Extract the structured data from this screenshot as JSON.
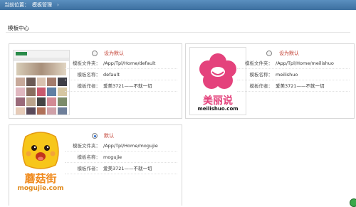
{
  "breadcrumb": {
    "prefix": "当前位置：",
    "current": "模板管理"
  },
  "page_title": "模板中心",
  "field_labels": {
    "path": "模板文件夹：",
    "name": "模板名称：",
    "author": "模板作者："
  },
  "templates": [
    {
      "status": "设为默认",
      "path": "/App/Tpl/Home/default",
      "name": "default",
      "author": "爱美3721——不就一切",
      "selected": false
    },
    {
      "status": "设为默认",
      "path": "/App/Tpl/Home/meilishuo",
      "name": "meilishuo",
      "author": "爱美3721——不就一切",
      "selected": false,
      "logo_text": "美丽说",
      "logo_url": "meilishuo.com"
    },
    {
      "status": "默认",
      "path": "/App/Tpl/Home/mogujie",
      "name": "mogujie",
      "author": "爱美3721——不就一切",
      "selected": true,
      "logo_text": "蘑菇街",
      "logo_url": "mogujie.com"
    }
  ],
  "colors": {
    "accent": "#c0392b",
    "topbar": "#4a7fb0",
    "meili_pink": "#e4427c",
    "mogu_orange": "#f08a1c"
  }
}
